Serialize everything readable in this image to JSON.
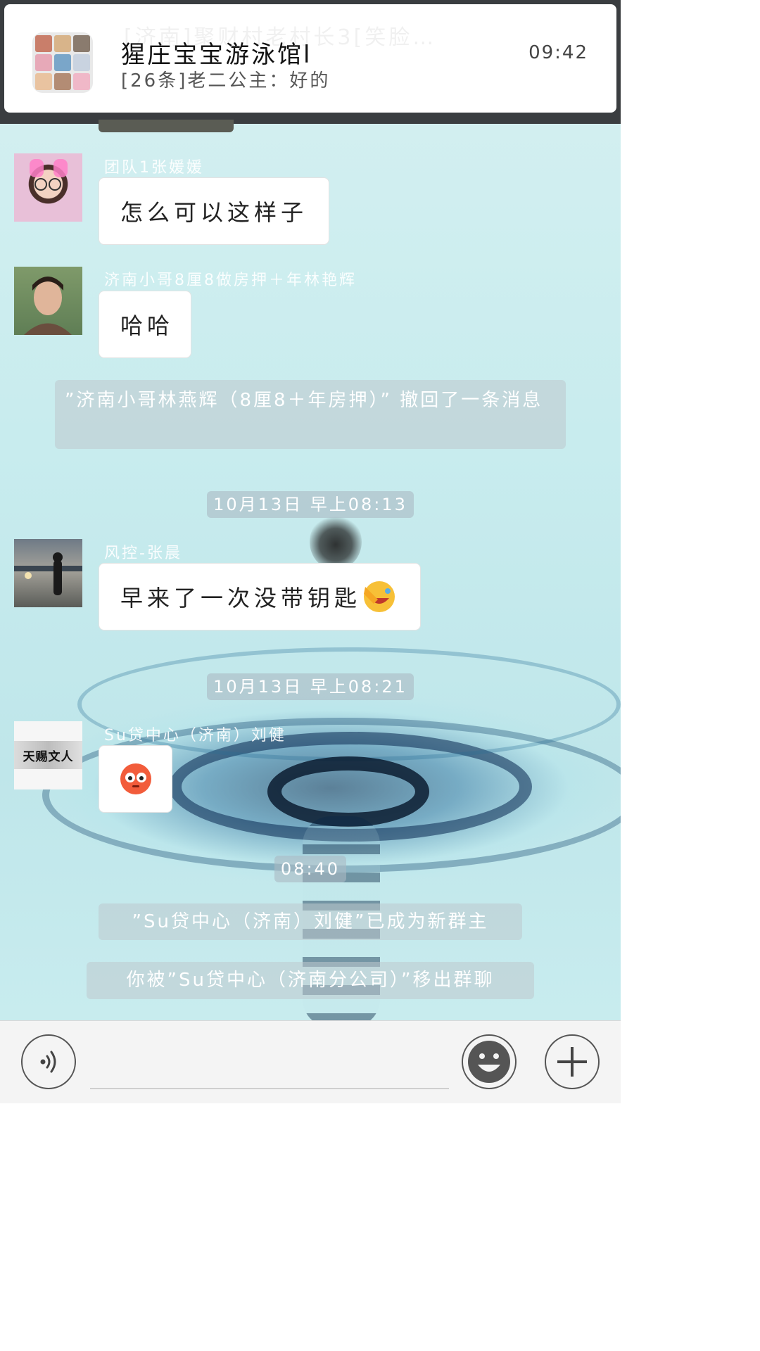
{
  "notification": {
    "group_name": "猩庄宝宝游泳馆l",
    "preview": "[26条]老二公主：好的",
    "time": "09:42",
    "ghost_text": "[济南]聚财村老村长3[笑脸…"
  },
  "messages": [
    {
      "sender": "团队1张媛媛",
      "text": "怎么可以这样子"
    },
    {
      "sender": "济南小哥8厘8做房押＋年林艳辉",
      "text": "哈哈"
    },
    {
      "system": "”济南小哥林燕辉（8厘8＋年房押）” 撤回了一条消息"
    },
    {
      "timestamp": "10月13日 早上08:13"
    },
    {
      "sender": "风控-张晨",
      "text": "早来了一次没带钥匙"
    },
    {
      "timestamp": "10月13日 早上08:21"
    },
    {
      "sender": "Su贷中心（济南）刘健",
      "avatar_text": "天赐文人"
    },
    {
      "timestamp": "08:40"
    },
    {
      "system": "”Su贷中心（济南）刘健”已成为新群主"
    },
    {
      "system": "你被”Su贷中心（济南分公司）”移出群聊"
    }
  ],
  "icons": {
    "voice": "voice-icon",
    "emoji": "emoji-icon",
    "add": "plus-icon"
  },
  "colors": {
    "bubble": "#ffffff",
    "system_bg": "#bec8cd",
    "banner": "#ffffff"
  }
}
